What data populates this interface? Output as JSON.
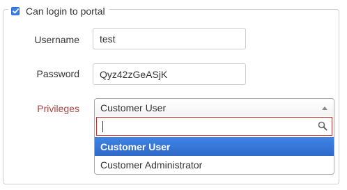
{
  "portal": {
    "checkbox_label": "Can login to portal",
    "checked": true
  },
  "fields": {
    "username": {
      "label": "Username",
      "value": "test"
    },
    "password": {
      "label": "Password",
      "value": "Qyz42zGeASjK"
    },
    "privileges": {
      "label": "Privileges",
      "selected": "Customer User",
      "search_value": "",
      "options": [
        "Customer User",
        "Customer Administrator"
      ],
      "highlighted_index": 0
    }
  },
  "colors": {
    "error_label": "#a94442",
    "search_border": "#c9302c",
    "highlight": "#3875d7",
    "checkbox": "#3b7fe5"
  },
  "icons": {
    "checkbox": "check-icon",
    "search": "search-icon",
    "select_arrow": "arrow-up-icon"
  }
}
